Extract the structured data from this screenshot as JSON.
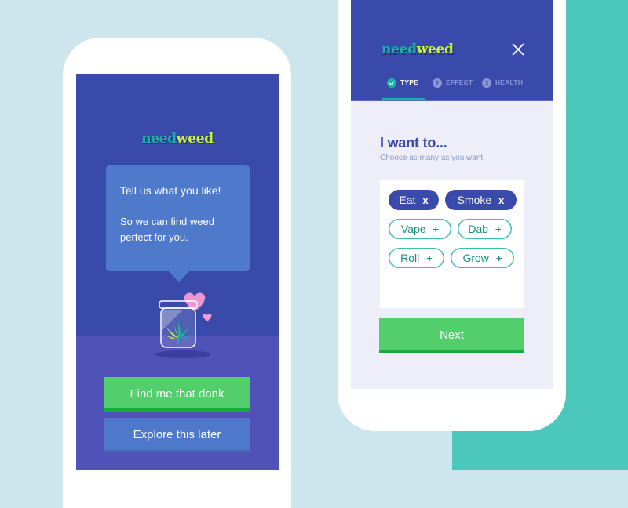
{
  "app": {
    "logo_part1": "need",
    "logo_part2": "weed"
  },
  "colors": {
    "brand_blue": "#3a4aab",
    "brand_teal": "#17b3a3",
    "brand_lime": "#c9f23b",
    "cta_green": "#52cf6c",
    "secondary_blue": "#4e79cb",
    "background_light": "#cde6ee",
    "background_teal": "#4cc7bc"
  },
  "welcome_screen": {
    "bubble_title": "Tell us what you like!",
    "bubble_body": "So we can find weed perfect for you.",
    "illustration": "jar-with-cannabis-leaf-and-hearts",
    "primary_button": "Find me that dank",
    "secondary_button": "Explore this later"
  },
  "type_screen": {
    "close_icon": "close-icon",
    "steps": [
      {
        "number": "✓",
        "label": "TYPE",
        "state": "completed-active"
      },
      {
        "number": "2",
        "label": "EFFECT",
        "state": "inactive"
      },
      {
        "number": "3",
        "label": "HEALTH",
        "state": "inactive"
      }
    ],
    "question_title": "I want to...",
    "question_subtitle": "Choose as many as you want",
    "options": [
      {
        "label": "Eat",
        "selected": true,
        "symbol": "x"
      },
      {
        "label": "Smoke",
        "selected": true,
        "symbol": "x"
      },
      {
        "label": "Vape",
        "selected": false,
        "symbol": "+"
      },
      {
        "label": "Dab",
        "selected": false,
        "symbol": "+"
      },
      {
        "label": "Roll",
        "selected": false,
        "symbol": "+"
      },
      {
        "label": "Grow",
        "selected": false,
        "symbol": "+"
      }
    ],
    "next_button": "Next"
  }
}
